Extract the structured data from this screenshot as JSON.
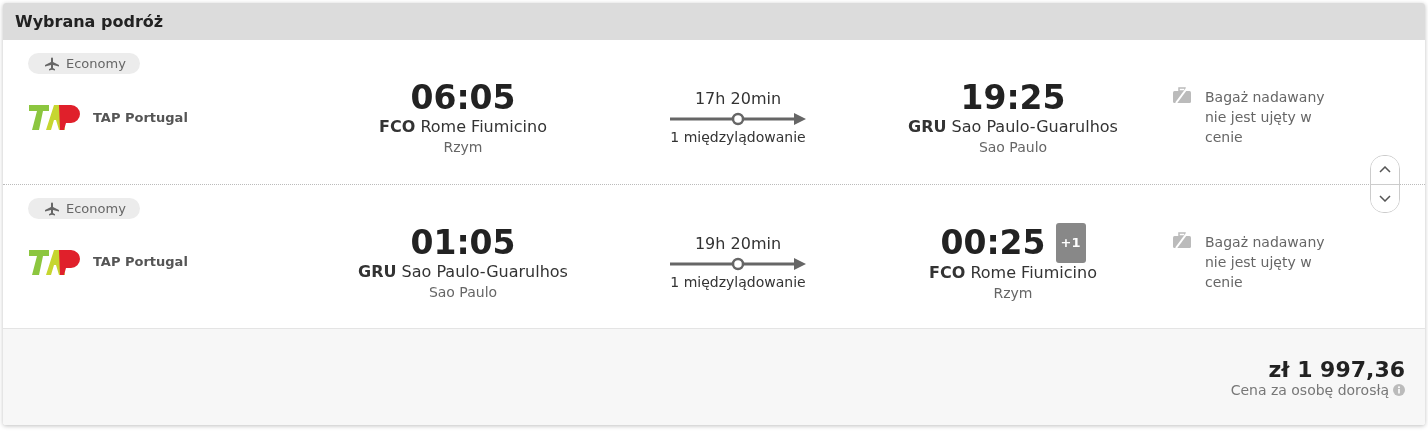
{
  "panel": {
    "title": "Wybrana podróż"
  },
  "legs": [
    {
      "cabin": "Economy",
      "airline": "TAP Portugal",
      "departure": {
        "time": "06:05",
        "airport": "**FCO** Rome Fiumicino",
        "city": "Rzym"
      },
      "duration": "17h 20min",
      "stops": "1 międzylądowanie",
      "arrival": {
        "time": "19:25",
        "airport": "**GRU** Sao Paulo-Guarulhos",
        "city": "Sao Paulo"
      },
      "baggage": "Bagaż nadawany nie jest ujęty w cenie"
    },
    {
      "cabin": "Economy",
      "airline": "TAP Portugal",
      "departure": {
        "time": "01:05",
        "airport": "**GRU** Sao Paulo-Guarulhos",
        "city": "Sao Paulo"
      },
      "duration": "19h 20min",
      "stops": "1 międzylądowanie",
      "arrival": {
        "time": "00:25",
        "day_offset": "+1",
        "airport": "**FCO** Rome Fiumicino",
        "city": "Rzym"
      },
      "baggage": "Bagaż nadawany nie jest ujęty w cenie"
    }
  ],
  "price": {
    "amount": "zł 1 997,36",
    "note": "Cena za osobę dorosłą"
  }
}
